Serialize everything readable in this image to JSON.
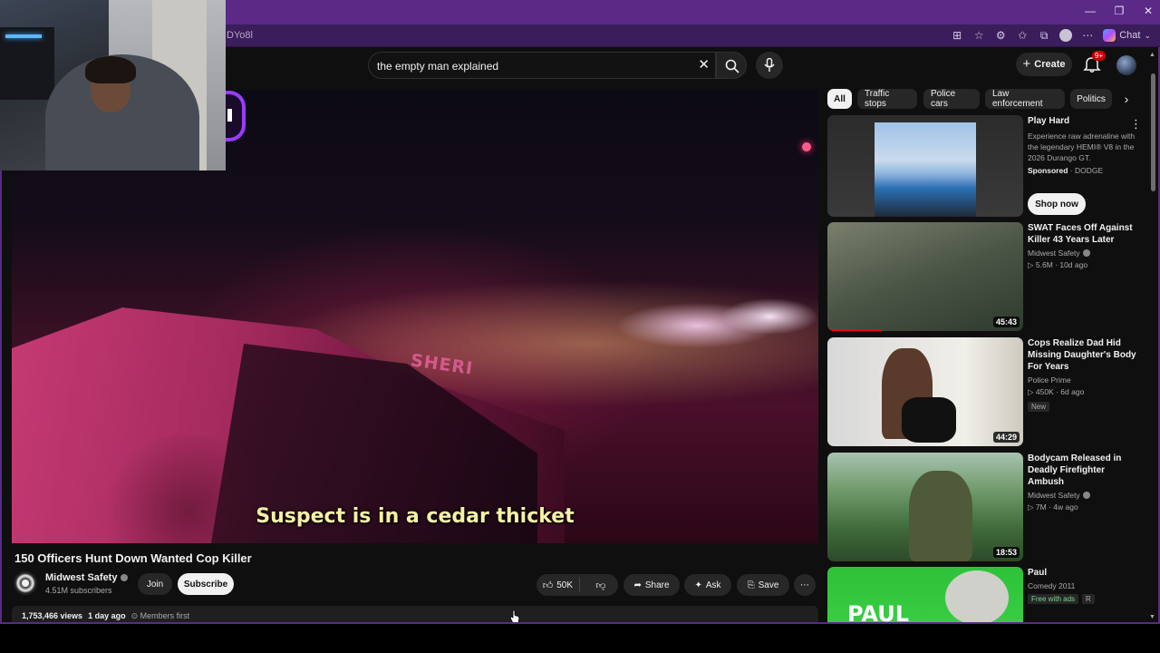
{
  "browser": {
    "url_fragment": "DYo8l",
    "chat_label": "Chat",
    "window_controls": [
      "minimize-icon",
      "restore-icon",
      "close-icon"
    ]
  },
  "masthead": {
    "search_value": "the empty man explained",
    "create_label": "Create",
    "notification_count": "9+"
  },
  "player": {
    "caption": "Suspect is in a cedar thicket",
    "vehicle_text": "SHERI"
  },
  "video": {
    "title": "150 Officers Hunt Down Wanted Cop Killer",
    "channel": "Midwest Safety",
    "subscribers": "4.51M subscribers",
    "join_label": "Join",
    "subscribe_label": "Subscribe",
    "likes": "50K",
    "share_label": "Share",
    "ask_label": "Ask",
    "save_label": "Save",
    "views": "1,753,466 views",
    "age": "1 day ago",
    "members": "Members first"
  },
  "chips": [
    "All",
    "Traffic stops",
    "Police cars",
    "Law enforcement",
    "Politics"
  ],
  "ad": {
    "title": "Play Hard",
    "description": "Experience raw adrenaline with the legendary HEMI® V8 in the 2026 Durango GT.",
    "sponsored": "Sponsored",
    "advertiser": "DODGE",
    "cta": "Shop now"
  },
  "recommendations": [
    {
      "title": "SWAT Faces Off Against Killer 43 Years Later",
      "channel": "Midwest Safety",
      "meta": "5.6M · 10d ago",
      "duration": "45:43",
      "badge": ""
    },
    {
      "title": "Cops Realize Dad Hid Missing Daughter's Body For Years",
      "channel": "Police Prime",
      "meta": "450K · 6d ago",
      "duration": "44:29",
      "badge": "New"
    },
    {
      "title": "Bodycam Released in Deadly Firefighter Ambush",
      "channel": "Midwest Safety",
      "meta": "7M · 4w ago",
      "duration": "18:53",
      "badge": ""
    },
    {
      "title": "Paul",
      "channel": "Comedy 2011",
      "meta": "",
      "duration": "",
      "badge": "Free with ads",
      "rating": "R",
      "thumb_text": "PAUL"
    }
  ],
  "colors": {
    "browser_frame": "#5a2a86",
    "page_bg": "#0f0f0f",
    "caption_text": "#f6f1a6",
    "notification_red": "#cc0000"
  }
}
